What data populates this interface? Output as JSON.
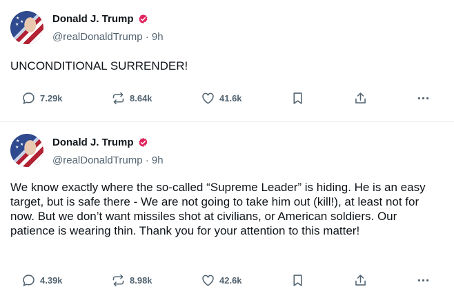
{
  "posts": [
    {
      "author": {
        "name": "Donald J. Trump",
        "handle": "@realDonaldTrump",
        "separator": "·",
        "time": "9h"
      },
      "text": "UNCONDITIONAL SURRENDER!",
      "stats": {
        "replies": "7.29k",
        "reposts": "8.64k",
        "likes": "41.6k"
      }
    },
    {
      "author": {
        "name": "Donald J. Trump",
        "handle": "@realDonaldTrump",
        "separator": "·",
        "time": "9h"
      },
      "text": "We know exactly where the so-called “Supreme Leader” is hiding. He is an easy target, but is safe there - We are not going to take him out (kill!), at least not for now. But we don’t want missiles shot at civilians, or American soldiers. Our patience is wearing thin. Thank you for your attention to this matter!",
      "stats": {
        "replies": "4.39k",
        "reposts": "8.98k",
        "likes": "42.6k"
      }
    }
  ],
  "icons": {
    "reply": "speech-bubble-icon",
    "repost": "repost-arrows-icon",
    "like": "heart-icon",
    "bookmark": "bookmark-icon",
    "share": "share-upload-icon",
    "more": "more-dots-icon",
    "verified": "verified-badge-icon"
  },
  "colors": {
    "verified_badge": "#e0245e",
    "text_primary": "#0f1419",
    "text_secondary": "#536471",
    "icon": "#536471",
    "divider": "#eceff1"
  }
}
